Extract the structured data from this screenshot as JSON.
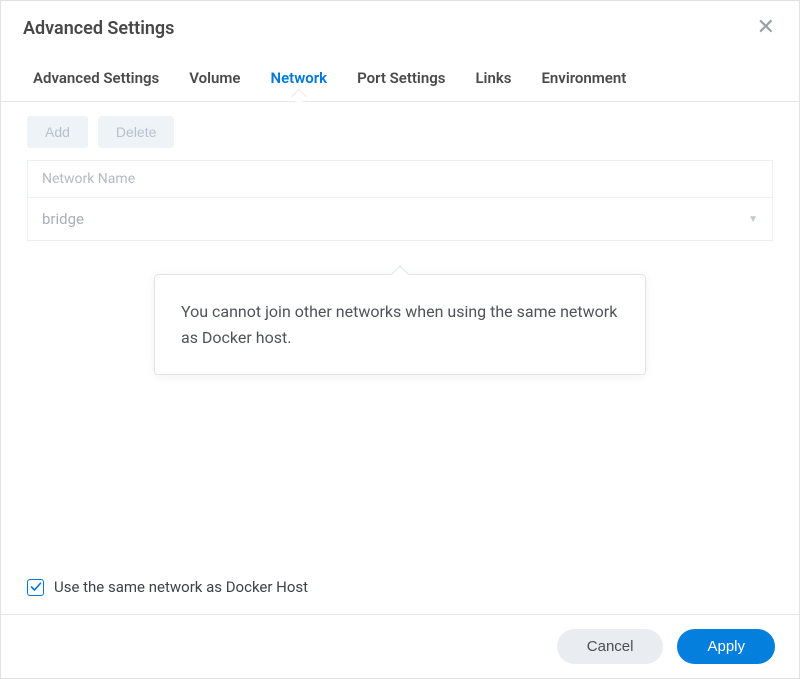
{
  "dialog": {
    "title": "Advanced Settings"
  },
  "tabs": {
    "advanced_settings": "Advanced Settings",
    "volume": "Volume",
    "network": "Network",
    "port_settings": "Port Settings",
    "links": "Links",
    "environment": "Environment",
    "active": "network"
  },
  "toolbar": {
    "add": "Add",
    "delete": "Delete"
  },
  "table": {
    "col_header": "Network Name",
    "rows": [
      {
        "name": "bridge"
      }
    ]
  },
  "tooltip": {
    "text": "You cannot join other networks when using the same network as Docker host."
  },
  "checkbox": {
    "label": "Use the same network as Docker Host",
    "checked": true
  },
  "footer": {
    "cancel": "Cancel",
    "apply": "Apply"
  }
}
